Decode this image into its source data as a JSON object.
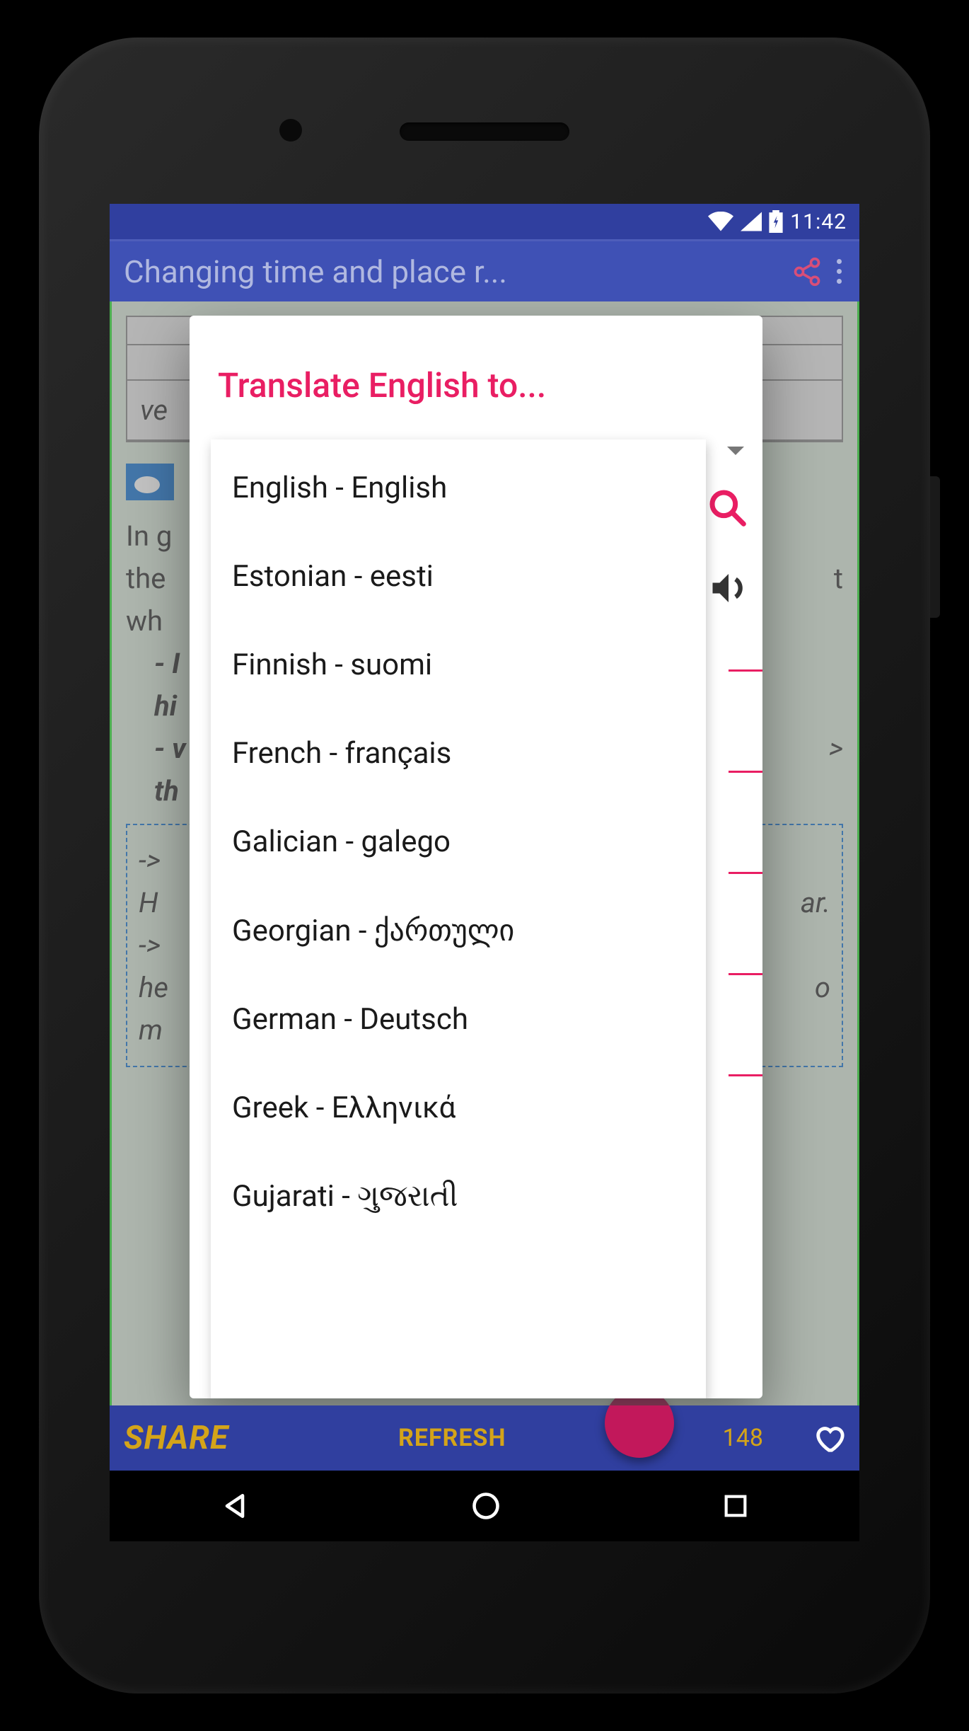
{
  "status": {
    "time": "11:42"
  },
  "appbar": {
    "title": "Changing time and place r..."
  },
  "dialog": {
    "title": "Translate English to...",
    "languages": [
      "English - English",
      "Estonian - eesti",
      "Finnish - suomi",
      "French - français",
      "Galician - galego",
      "Georgian - ქართული",
      "German - Deutsch",
      "Greek - Ελληνικά",
      "Gujarati - ગુજરાતી"
    ]
  },
  "bottom": {
    "share": "SHARE",
    "refresh": "REFRESH",
    "count": "148"
  },
  "bg": {
    "row2": "ve",
    "p1": "In g",
    "p2": "the",
    "p3": "wh",
    "i1": "- I",
    "i2": "hi",
    "i3": "- v",
    "i4": "th",
    "b1": "->",
    "b2": "H",
    "b3": "->",
    "b4": "he",
    "b5": "m",
    "rt": "t",
    "rar": "ar.",
    "ro": "o"
  }
}
